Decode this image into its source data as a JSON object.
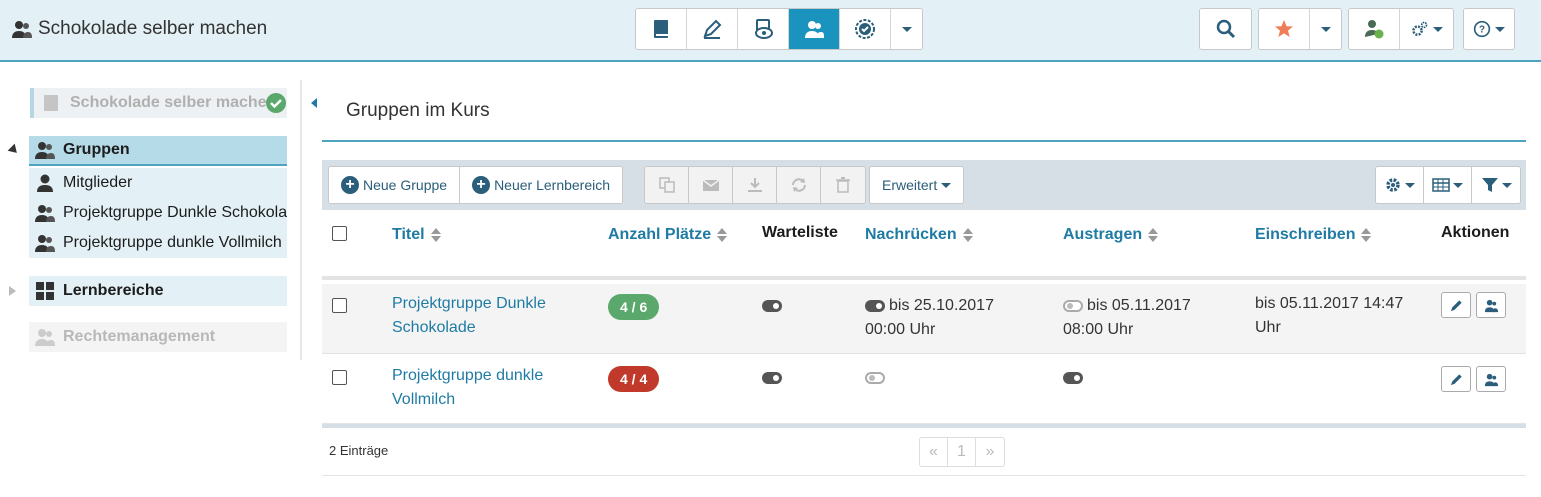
{
  "header": {
    "course_title": "Schokolade selber machen",
    "toolbar_icons": [
      "book-icon",
      "pencil-icon",
      "eye-icon",
      "members-icon",
      "assessment-icon",
      "chevron-down-icon"
    ],
    "active_tool": "members-icon",
    "right_icons": [
      "search-icon",
      "star-icon",
      "chevron-down-icon",
      "user-globe-icon",
      "settings-icon",
      "help-icon"
    ]
  },
  "sidebar": {
    "home": "Schokolade selber machen",
    "sections": {
      "gruppen": "Gruppen",
      "lernbereiche": "Lernbereiche",
      "rechte": "Rechtemanagement"
    },
    "gruppen_items": [
      "Mitglieder",
      "Projektgruppe Dunkle Schokolade",
      "Projektgruppe dunkle Vollmilch"
    ]
  },
  "main": {
    "title": "Gruppen im Kurs",
    "buttons": {
      "new_group": "Neue Gruppe",
      "new_area": "Neuer Lernbereich",
      "advanced": "Erweitert"
    },
    "columns": {
      "title": "Titel",
      "places": "Anzahl Plätze",
      "waitlist": "Warteliste",
      "nachruecken": "Nachrücken",
      "austragen": "Austragen",
      "einschreiben": "Einschreiben",
      "actions": "Aktionen"
    },
    "rows": [
      {
        "title": "Projektgruppe Dunkle Schokolade",
        "places": "4 / 6",
        "places_color": "#5aa86b",
        "waitlist": "on",
        "nachruecken": "bis 25.10.2017 00:00 Uhr",
        "nachruecken_toggle": "on",
        "austragen": "bis 05.11.2017 08:00 Uhr",
        "austragen_toggle": "off",
        "einschreiben": "bis 05.11.2017 14:47 Uhr"
      },
      {
        "title": "Projektgruppe dunkle Vollmilch",
        "places": "4 / 4",
        "places_color": "#c0392b",
        "waitlist": "on",
        "nachruecken_toggle": "off",
        "austragen_toggle": "on",
        "einschreiben": ""
      }
    ],
    "entries": "2 Einträge",
    "pager": {
      "prev": "«",
      "page": "1",
      "next": "»"
    }
  },
  "colors": {
    "accent": "#1a94bf",
    "header_bg": "#e3f1f7",
    "link": "#1f7ba4"
  }
}
